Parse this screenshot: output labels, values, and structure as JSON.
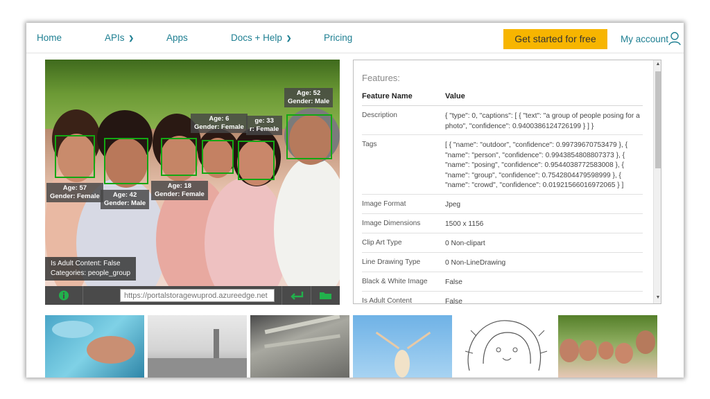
{
  "nav": {
    "home": "Home",
    "apis": "APIs",
    "apps": "Apps",
    "docs": "Docs + Help",
    "pricing": "Pricing",
    "cta": "Get started for free",
    "account": "My account"
  },
  "colors": {
    "link": "#1e7f92",
    "cta": "#f7b500",
    "face_box": "#13a813"
  },
  "faces": [
    {
      "age": "Age: 57",
      "gender": "Gender: Female"
    },
    {
      "age": "Age: 42",
      "gender": "Gender: Male"
    },
    {
      "age": "Age: 18",
      "gender": "Gender: Female"
    },
    {
      "age": "Age: 6",
      "gender": "Gender: Female"
    },
    {
      "age": "ge: 33",
      "gender": "r: Female"
    },
    {
      "age": "Age: 52",
      "gender": "Gender: Male"
    }
  ],
  "image_info": {
    "adult": "Is Adult Content: False",
    "categories": "Categories: people_group"
  },
  "toolbar": {
    "info_icon": "info-icon",
    "url_placeholder": "https://portalstoragewuprod.azureedge.net",
    "submit_icon": "enter-icon",
    "folder_icon": "folder-icon"
  },
  "features": {
    "title": "Features:",
    "col_name": "Feature Name",
    "col_value": "Value",
    "rows": [
      {
        "name": "Description",
        "value": "{ \"type\": 0, \"captions\": [ { \"text\": \"a group of people posing for a photo\", \"confidence\": 0.9400386124726199 } ] }"
      },
      {
        "name": "Tags",
        "value": "[ { \"name\": \"outdoor\", \"confidence\": 0.99739670753479 }, { \"name\": \"person\", \"confidence\": 0.9943854808807373 }, { \"name\": \"posing\", \"confidence\": 0.9544038772583008 }, { \"name\": \"group\", \"confidence\": 0.7542804479598999 }, { \"name\": \"crowd\", \"confidence\": 0.01921566016972065 } ]"
      },
      {
        "name": "Image Format",
        "value": "Jpeg"
      },
      {
        "name": "Image Dimensions",
        "value": "1500 x 1156"
      },
      {
        "name": "Clip Art Type",
        "value": "0 Non-clipart"
      },
      {
        "name": "Line Drawing Type",
        "value": "0 Non-LineDrawing"
      },
      {
        "name": "Black & White Image",
        "value": "False"
      },
      {
        "name": "Is Adult Content",
        "value": "False"
      }
    ]
  },
  "thumbnails": [
    "swimmer",
    "city-skyline",
    "subway-station",
    "woman-jumping",
    "lion-line-drawing",
    "family-group"
  ]
}
